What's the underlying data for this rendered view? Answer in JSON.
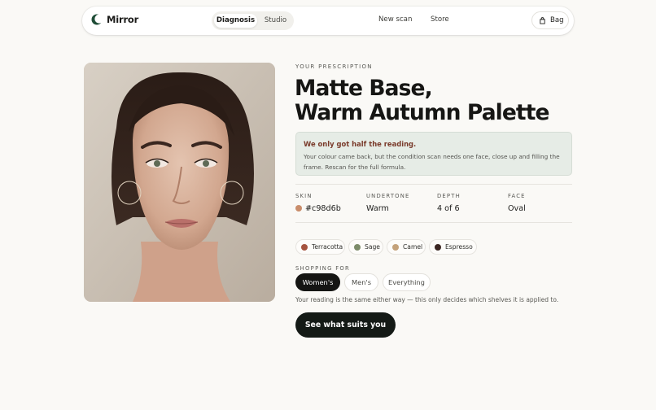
{
  "app": {
    "name": "Mirror",
    "moon_color": "#1f4d37"
  },
  "nav": {
    "segments": [
      "Diagnosis",
      "Studio"
    ],
    "links": [
      "New scan",
      "Store"
    ],
    "bag_label": "Bag"
  },
  "portrait": {
    "description_icon": "portrait-photo"
  },
  "prescription": {
    "eyebrow": "YOUR PRESCRIPTION",
    "title_line1": "Matte Base,",
    "title_line2": "Warm Autumn Palette"
  },
  "notice": {
    "title": "We only got half the reading.",
    "body": "Your colour came back, but the condition scan needs one face, close up and filling the frame. Rescan for the full formula."
  },
  "stats": [
    {
      "label": "SKIN",
      "value": "#c98d6b",
      "swatch": "#c98d6b"
    },
    {
      "label": "UNDERTONE",
      "value": "Warm"
    },
    {
      "label": "DEPTH",
      "value": "4 of 6"
    },
    {
      "label": "FACE",
      "value": "Oval"
    }
  ],
  "palette": [
    {
      "name": "Terracotta",
      "color": "#a5533f"
    },
    {
      "name": "Sage",
      "color": "#7d8c6a"
    },
    {
      "name": "Camel",
      "color": "#c4a27a"
    },
    {
      "name": "Espresso",
      "color": "#3b2622"
    }
  ],
  "shopping": {
    "label": "SHOPPING FOR",
    "options": [
      "Women's",
      "Men's",
      "Everything"
    ],
    "selected": "Women's",
    "note": "Your reading is the same either way — this only decides which shelves it is applied to."
  },
  "cta_label": "See what suits you"
}
